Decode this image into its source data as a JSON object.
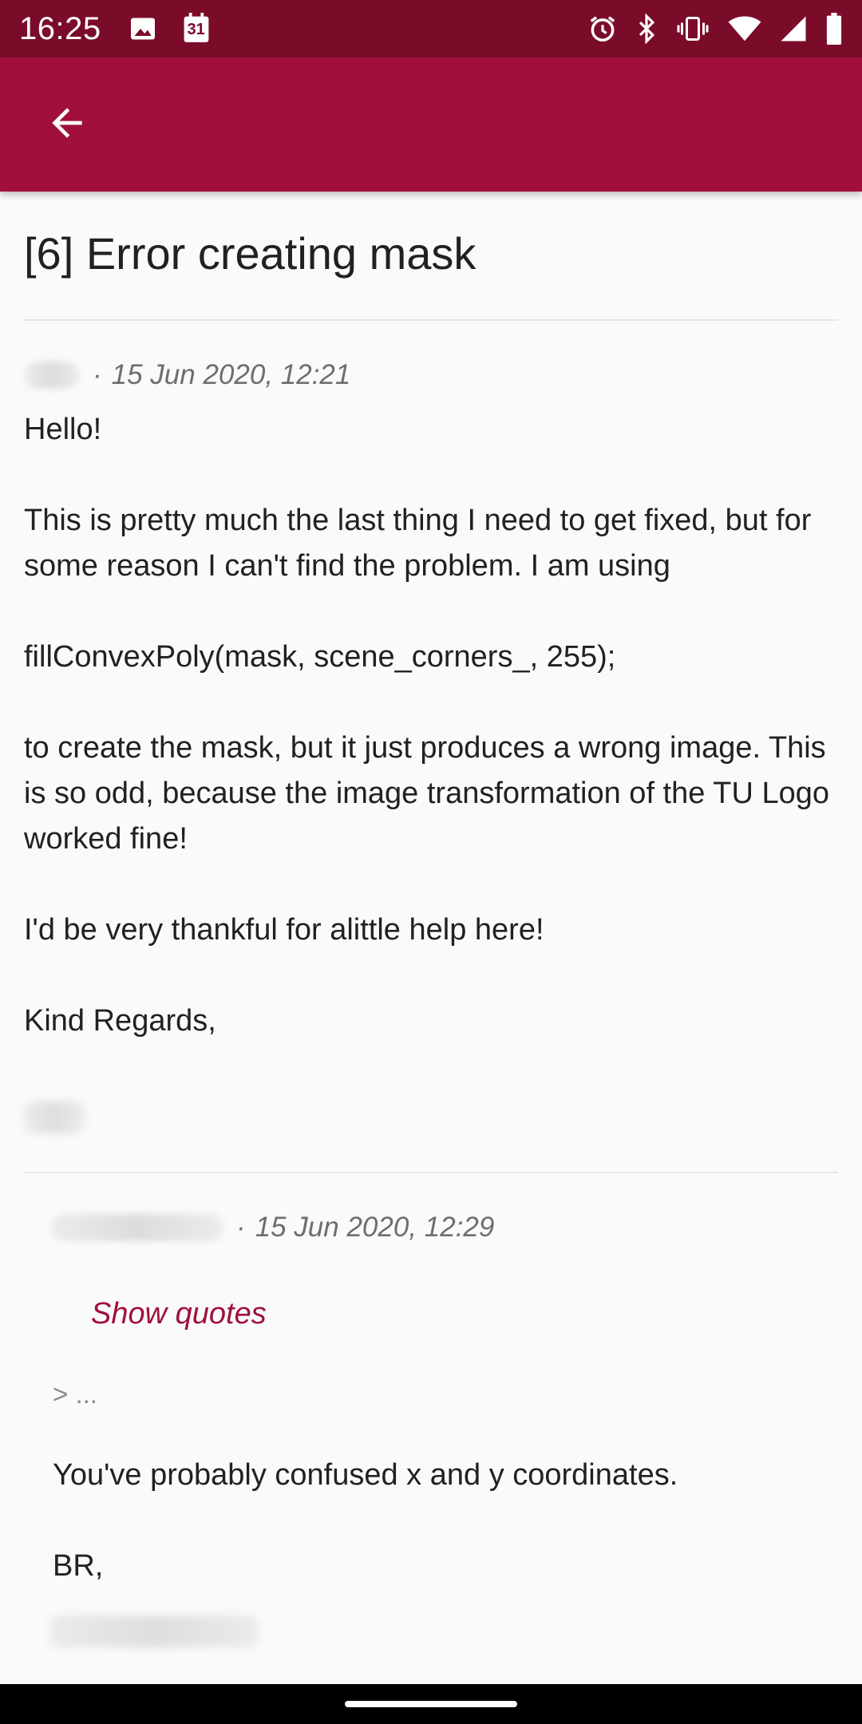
{
  "status_bar": {
    "time": "16:25",
    "left_icons": [
      "image-icon",
      "calendar-icon"
    ],
    "calendar_day": "31",
    "right_icons": [
      "alarm-icon",
      "bluetooth-icon",
      "vibrate-icon",
      "wifi-icon",
      "cell-signal-icon",
      "battery-icon"
    ]
  },
  "app_bar": {
    "back_icon": "arrow-back-icon",
    "color": "#a0103a"
  },
  "thread": {
    "title": "[6] Error creating mask"
  },
  "posts": [
    {
      "date": "15 Jun 2020, 12:21",
      "body": "Hello!\n\nThis is pretty much the last thing I need to get fixed, but for some reason I can't find the problem. I am using\n\nfillConvexPoly(mask, scene_corners_, 255);\n\nto create the mask, but it just produces a wrong image. This is so odd, because the image transformation of the TU Logo worked fine!\n\nI'd be very thankful for alittle help here!\n\nKind Regards,"
    },
    {
      "date": "15 Jun 2020, 12:29",
      "show_quotes_label": "Show quotes",
      "collapsed_quote": "> ...",
      "body": "You've probably confused x and y coordinates.\n\nBR,"
    }
  ],
  "colors": {
    "status_bar": "#7a0c2a",
    "app_bar": "#a0103a",
    "accent": "#a0103a"
  }
}
